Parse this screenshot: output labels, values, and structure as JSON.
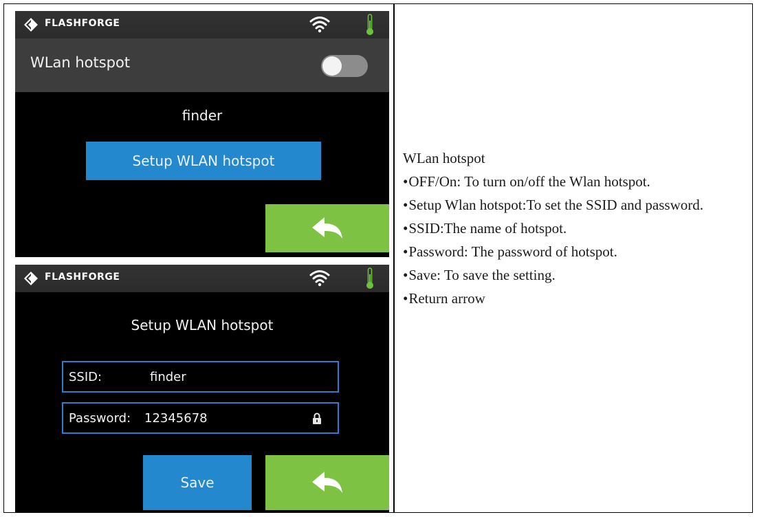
{
  "brand": {
    "name": "FLASHFORGE"
  },
  "screen1": {
    "hotspot_label": "WLan hotspot",
    "toggle_state": "off",
    "hotspot_name": "finder",
    "setup_button_label": "Setup WLAN hotspot"
  },
  "screen2": {
    "title": "Setup WLAN hotspot",
    "ssid_label": "SSID:",
    "ssid_value": "finder",
    "password_label": "Password:",
    "password_value": "12345678",
    "save_button_label": "Save"
  },
  "description": {
    "heading": "WLan hotspot",
    "bullet": "•",
    "items": [
      "OFF/On: To turn on/off the Wlan hotspot.",
      "Setup Wlan hotspot:To set the SSID and password.",
      "SSID:The name of hotspot.",
      "Password: The password of hotspot.",
      "Save: To save the setting.",
      "Return arrow"
    ]
  },
  "icons": {
    "logo": "flashforge-logo-icon",
    "wifi": "wifi-icon",
    "thermometer": "thermometer-icon",
    "back": "back-arrow-icon",
    "lock": "lock-icon"
  },
  "colors": {
    "screen_bg": "#000000",
    "status_bar": "#2e2e2e",
    "hotspot_row": "#3d3d3d",
    "blue_button": "#2488cf",
    "green_button": "#7dc242",
    "field_border": "#2a7fd0",
    "thermometer": "#6ec13f"
  }
}
